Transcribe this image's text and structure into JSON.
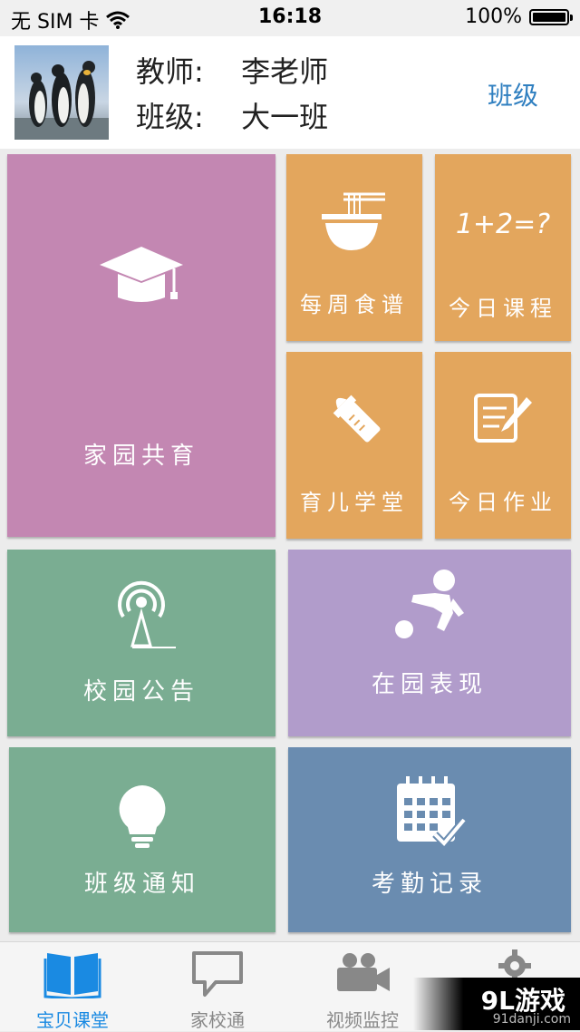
{
  "status_bar": {
    "carrier": "无 SIM 卡",
    "time": "16:18",
    "battery": "100%",
    "battery_level": 1.0
  },
  "profile": {
    "teacher_label": "教师:",
    "teacher_name": "李老师",
    "class_label": "班级:",
    "class_name": "大一班",
    "class_button": "班级"
  },
  "tiles": {
    "home_school": {
      "label": "家园共育",
      "icon": "graduation-cap-icon",
      "color": "#c387b2"
    },
    "weekly_menu": {
      "label": "每周食谱",
      "icon": "noodle-bowl-icon",
      "color": "#e3a65d"
    },
    "today_course": {
      "label": "今日课程",
      "icon": "math-equation-icon",
      "icon_text": "1+2=?",
      "color": "#e3a65d"
    },
    "parenting": {
      "label": "育儿学堂",
      "icon": "baby-bottle-icon",
      "color": "#e3a65d"
    },
    "homework": {
      "label": "今日作业",
      "icon": "notepad-pencil-icon",
      "color": "#e3a65d"
    },
    "notice": {
      "label": "校园公告",
      "icon": "broadcast-antenna-icon",
      "color": "#7aad92"
    },
    "performance": {
      "label": "在园表现",
      "icon": "soccer-player-icon",
      "color": "#b19ccb"
    },
    "class_notice": {
      "label": "班级通知",
      "icon": "light-bulb-icon",
      "color": "#7aad92"
    },
    "attendance": {
      "label": "考勤记录",
      "icon": "calendar-check-icon",
      "color": "#6a8cb0"
    }
  },
  "tab_bar": {
    "items": [
      {
        "label": "宝贝课堂",
        "icon": "open-book-icon",
        "active": true
      },
      {
        "label": "家校通",
        "icon": "speech-bubble-icon",
        "active": false
      },
      {
        "label": "视频监控",
        "icon": "video-camera-icon",
        "active": false
      },
      {
        "label": "",
        "icon": "gear-icon",
        "active": false
      }
    ]
  },
  "watermark": {
    "brand": "9L游戏",
    "site": "91danji.com"
  },
  "colors": {
    "accent": "#1a8ae2",
    "link": "#2f7fc0"
  }
}
